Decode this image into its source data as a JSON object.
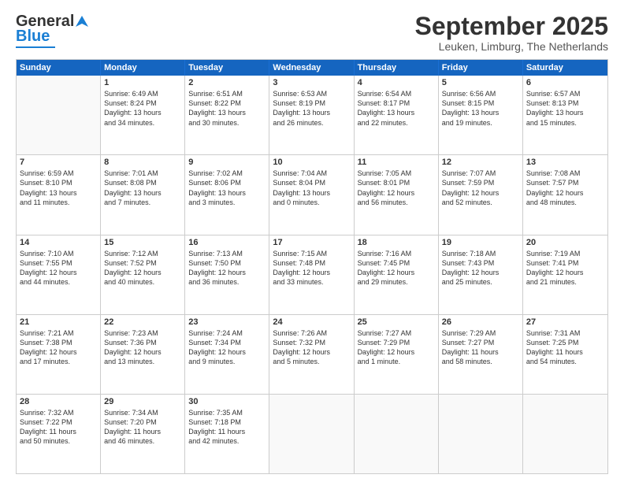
{
  "header": {
    "logo_line1": "General",
    "logo_line2": "Blue",
    "month_title": "September 2025",
    "location": "Leuken, Limburg, The Netherlands"
  },
  "weekdays": [
    "Sunday",
    "Monday",
    "Tuesday",
    "Wednesday",
    "Thursday",
    "Friday",
    "Saturday"
  ],
  "weeks": [
    [
      {
        "day": "",
        "info": ""
      },
      {
        "day": "1",
        "info": "Sunrise: 6:49 AM\nSunset: 8:24 PM\nDaylight: 13 hours\nand 34 minutes."
      },
      {
        "day": "2",
        "info": "Sunrise: 6:51 AM\nSunset: 8:22 PM\nDaylight: 13 hours\nand 30 minutes."
      },
      {
        "day": "3",
        "info": "Sunrise: 6:53 AM\nSunset: 8:19 PM\nDaylight: 13 hours\nand 26 minutes."
      },
      {
        "day": "4",
        "info": "Sunrise: 6:54 AM\nSunset: 8:17 PM\nDaylight: 13 hours\nand 22 minutes."
      },
      {
        "day": "5",
        "info": "Sunrise: 6:56 AM\nSunset: 8:15 PM\nDaylight: 13 hours\nand 19 minutes."
      },
      {
        "day": "6",
        "info": "Sunrise: 6:57 AM\nSunset: 8:13 PM\nDaylight: 13 hours\nand 15 minutes."
      }
    ],
    [
      {
        "day": "7",
        "info": "Sunrise: 6:59 AM\nSunset: 8:10 PM\nDaylight: 13 hours\nand 11 minutes."
      },
      {
        "day": "8",
        "info": "Sunrise: 7:01 AM\nSunset: 8:08 PM\nDaylight: 13 hours\nand 7 minutes."
      },
      {
        "day": "9",
        "info": "Sunrise: 7:02 AM\nSunset: 8:06 PM\nDaylight: 13 hours\nand 3 minutes."
      },
      {
        "day": "10",
        "info": "Sunrise: 7:04 AM\nSunset: 8:04 PM\nDaylight: 13 hours\nand 0 minutes."
      },
      {
        "day": "11",
        "info": "Sunrise: 7:05 AM\nSunset: 8:01 PM\nDaylight: 12 hours\nand 56 minutes."
      },
      {
        "day": "12",
        "info": "Sunrise: 7:07 AM\nSunset: 7:59 PM\nDaylight: 12 hours\nand 52 minutes."
      },
      {
        "day": "13",
        "info": "Sunrise: 7:08 AM\nSunset: 7:57 PM\nDaylight: 12 hours\nand 48 minutes."
      }
    ],
    [
      {
        "day": "14",
        "info": "Sunrise: 7:10 AM\nSunset: 7:55 PM\nDaylight: 12 hours\nand 44 minutes."
      },
      {
        "day": "15",
        "info": "Sunrise: 7:12 AM\nSunset: 7:52 PM\nDaylight: 12 hours\nand 40 minutes."
      },
      {
        "day": "16",
        "info": "Sunrise: 7:13 AM\nSunset: 7:50 PM\nDaylight: 12 hours\nand 36 minutes."
      },
      {
        "day": "17",
        "info": "Sunrise: 7:15 AM\nSunset: 7:48 PM\nDaylight: 12 hours\nand 33 minutes."
      },
      {
        "day": "18",
        "info": "Sunrise: 7:16 AM\nSunset: 7:45 PM\nDaylight: 12 hours\nand 29 minutes."
      },
      {
        "day": "19",
        "info": "Sunrise: 7:18 AM\nSunset: 7:43 PM\nDaylight: 12 hours\nand 25 minutes."
      },
      {
        "day": "20",
        "info": "Sunrise: 7:19 AM\nSunset: 7:41 PM\nDaylight: 12 hours\nand 21 minutes."
      }
    ],
    [
      {
        "day": "21",
        "info": "Sunrise: 7:21 AM\nSunset: 7:38 PM\nDaylight: 12 hours\nand 17 minutes."
      },
      {
        "day": "22",
        "info": "Sunrise: 7:23 AM\nSunset: 7:36 PM\nDaylight: 12 hours\nand 13 minutes."
      },
      {
        "day": "23",
        "info": "Sunrise: 7:24 AM\nSunset: 7:34 PM\nDaylight: 12 hours\nand 9 minutes."
      },
      {
        "day": "24",
        "info": "Sunrise: 7:26 AM\nSunset: 7:32 PM\nDaylight: 12 hours\nand 5 minutes."
      },
      {
        "day": "25",
        "info": "Sunrise: 7:27 AM\nSunset: 7:29 PM\nDaylight: 12 hours\nand 1 minute."
      },
      {
        "day": "26",
        "info": "Sunrise: 7:29 AM\nSunset: 7:27 PM\nDaylight: 11 hours\nand 58 minutes."
      },
      {
        "day": "27",
        "info": "Sunrise: 7:31 AM\nSunset: 7:25 PM\nDaylight: 11 hours\nand 54 minutes."
      }
    ],
    [
      {
        "day": "28",
        "info": "Sunrise: 7:32 AM\nSunset: 7:22 PM\nDaylight: 11 hours\nand 50 minutes."
      },
      {
        "day": "29",
        "info": "Sunrise: 7:34 AM\nSunset: 7:20 PM\nDaylight: 11 hours\nand 46 minutes."
      },
      {
        "day": "30",
        "info": "Sunrise: 7:35 AM\nSunset: 7:18 PM\nDaylight: 11 hours\nand 42 minutes."
      },
      {
        "day": "",
        "info": ""
      },
      {
        "day": "",
        "info": ""
      },
      {
        "day": "",
        "info": ""
      },
      {
        "day": "",
        "info": ""
      }
    ]
  ]
}
